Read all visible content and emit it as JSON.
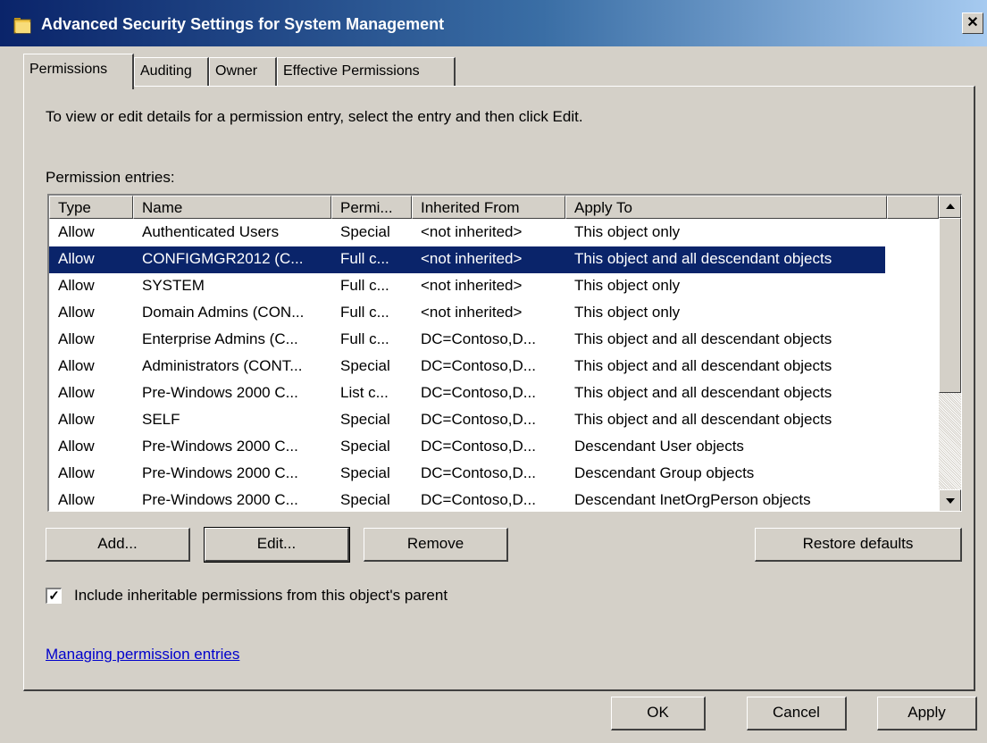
{
  "window": {
    "title": "Advanced Security Settings for System Management",
    "close_glyph": "✕"
  },
  "tabs": [
    {
      "label": "Permissions",
      "active": true
    },
    {
      "label": "Auditing",
      "active": false
    },
    {
      "label": "Owner",
      "active": false
    },
    {
      "label": "Effective Permissions",
      "active": false
    }
  ],
  "permissions": {
    "instruction": "To view or edit details for a permission entry, select the entry and then click Edit.",
    "entries_label": "Permission entries:",
    "columns": [
      "Type",
      "Name",
      "Permi...",
      "Inherited From",
      "Apply To"
    ],
    "rows": [
      {
        "type": "Allow",
        "name": "Authenticated Users",
        "permission": "Special",
        "inherited_from": "<not inherited>",
        "apply_to": "This object only",
        "selected": false
      },
      {
        "type": "Allow",
        "name": "CONFIGMGR2012 (C...",
        "permission": "Full c...",
        "inherited_from": "<not inherited>",
        "apply_to": "This object and all descendant objects",
        "selected": true
      },
      {
        "type": "Allow",
        "name": "SYSTEM",
        "permission": "Full c...",
        "inherited_from": "<not inherited>",
        "apply_to": "This object only",
        "selected": false
      },
      {
        "type": "Allow",
        "name": "Domain Admins (CON...",
        "permission": "Full c...",
        "inherited_from": "<not inherited>",
        "apply_to": "This object only",
        "selected": false
      },
      {
        "type": "Allow",
        "name": "Enterprise Admins (C...",
        "permission": "Full c...",
        "inherited_from": "DC=Contoso,D...",
        "apply_to": "This object and all descendant objects",
        "selected": false
      },
      {
        "type": "Allow",
        "name": "Administrators (CONT...",
        "permission": "Special",
        "inherited_from": "DC=Contoso,D...",
        "apply_to": "This object and all descendant objects",
        "selected": false
      },
      {
        "type": "Allow",
        "name": "Pre-Windows 2000 C...",
        "permission": "List c...",
        "inherited_from": "DC=Contoso,D...",
        "apply_to": "This object and all descendant objects",
        "selected": false
      },
      {
        "type": "Allow",
        "name": "SELF",
        "permission": "Special",
        "inherited_from": "DC=Contoso,D...",
        "apply_to": "This object and all descendant objects",
        "selected": false
      },
      {
        "type": "Allow",
        "name": "Pre-Windows 2000 C...",
        "permission": "Special",
        "inherited_from": "DC=Contoso,D...",
        "apply_to": "Descendant User objects",
        "selected": false
      },
      {
        "type": "Allow",
        "name": "Pre-Windows 2000 C...",
        "permission": "Special",
        "inherited_from": "DC=Contoso,D...",
        "apply_to": "Descendant Group objects",
        "selected": false
      },
      {
        "type": "Allow",
        "name": "Pre-Windows 2000 C...",
        "permission": "Special",
        "inherited_from": "DC=Contoso,D...",
        "apply_to": "Descendant InetOrgPerson objects",
        "selected": false
      }
    ],
    "buttons": {
      "add": "Add...",
      "edit": "Edit...",
      "remove": "Remove",
      "restore": "Restore defaults"
    },
    "include_inheritable": {
      "label": "Include inheritable permissions from this object's parent",
      "checked": true,
      "check_glyph": "✓"
    },
    "help_link": "Managing permission entries"
  },
  "dialog_buttons": {
    "ok": "OK",
    "cancel": "Cancel",
    "apply": "Apply"
  }
}
